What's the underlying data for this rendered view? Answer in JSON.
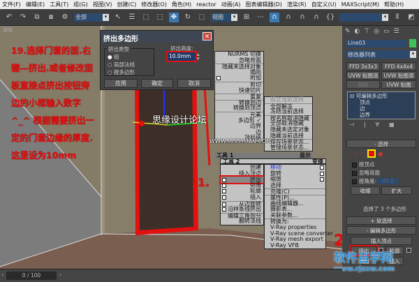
{
  "menubar": [
    "文件(F)",
    "编辑(E)",
    "工具(T)",
    "组(G)",
    "视图(V)",
    "创建(C)",
    "修改器(O)",
    "角色(H)",
    "reactor",
    "动画(A)",
    "图表编辑器(D)",
    "渲染(R)",
    "自定义(U)",
    "MAXScript(M)",
    "帮助(H)"
  ],
  "toolbar": {
    "selection_filter": "全部",
    "ref_coord": "视图",
    "named_sel": ""
  },
  "viewport": {
    "label": "透视",
    "watermark_cn": "思缘设计论坛",
    "watermark_url": "WWW.MISSYUAN.COM"
  },
  "annotation": {
    "text": "19.选择门套的面.右键—挤出.或者修改面板直接点挤出按钮旁边的小框输入数字^_^  根据需要挤出一定的门套边缘的厚度.这里设为10mm",
    "step1": "1.",
    "step2": "2"
  },
  "dialog": {
    "title": "挤出多边形",
    "group_label": "挤出类型",
    "options": [
      "组",
      "局部法线",
      "按多边形"
    ],
    "selected": "组",
    "height_label": "挤出高度:",
    "height_value": "10.0mm",
    "apply": "应用",
    "ok": "确定",
    "cancel": "取消"
  },
  "quad_tl": [
    "NURMS 切换",
    "忽略背面",
    "隐藏未选择对象",
    "塌陷",
    "附加",
    "剪切",
    "快速切片",
    "重复",
    "转换到边",
    "转换到顶点",
    "元素",
    "多边形 ✓",
    "边界",
    "边",
    "顶层级"
  ],
  "quad_tr": [
    "孤立当前选择",
    "全部解冻",
    "冻结当前选择",
    "按名称取消隐藏",
    "全部取消隐藏",
    "隐藏未选定对象",
    "隐藏当前选择",
    "保存场景状态...",
    "管理场景状态..."
  ],
  "quad_hdr1": {
    "left": "工具 1",
    "right": "显示"
  },
  "quad_hdr2": {
    "left": "工具 2",
    "right": "变换"
  },
  "quad_bl": [
    "创建",
    "插入顶点",
    "挤出",
    "倒角",
    "轮廓",
    "插入",
    "从边旋转",
    "沿样条线挤出",
    "编辑三角剖分",
    "翻转法线"
  ],
  "quad_br": [
    "移动",
    "旋转",
    "缩放",
    "选择",
    "克隆(C)",
    "属性(P)...",
    "曲线编辑器...",
    "摄影表...",
    "关联参数...",
    "转换为:",
    "V-Ray properties",
    "V-Ray scene converter",
    "V-Ray mesh export",
    "V-Ray VFB"
  ],
  "panel": {
    "object_name": "Line03",
    "object_color": "#3fc05a",
    "modifier_list": "修改器列表",
    "buttons": [
      "FFD 3x3x3",
      "FFD 4x4x4",
      "UVW 贴图清除",
      "UVW 贴图添加",
      "网格",
      "UVW 贴图"
    ],
    "stack": [
      "可编辑多边形",
      "顶点",
      "边",
      "边界"
    ],
    "rollout_select": "选择",
    "checks": [
      "按顶点",
      "忽略背面",
      "按角度:"
    ],
    "angle": "45.0",
    "shrink": "收缩",
    "grow": "扩大",
    "sel_status": "选择了 3 个多边形",
    "rollout_soft": "软选择",
    "rollout_edit": "编辑多边形",
    "insert_vertex": "插入顶点",
    "extrude": "挤出",
    "outline": "轮廓",
    "bevel": "倒角",
    "inset": "插入"
  },
  "timeline": {
    "frame": "0 / 100"
  },
  "logo": {
    "cn": "软件自学网",
    "url": "www.rjzxw.com"
  }
}
